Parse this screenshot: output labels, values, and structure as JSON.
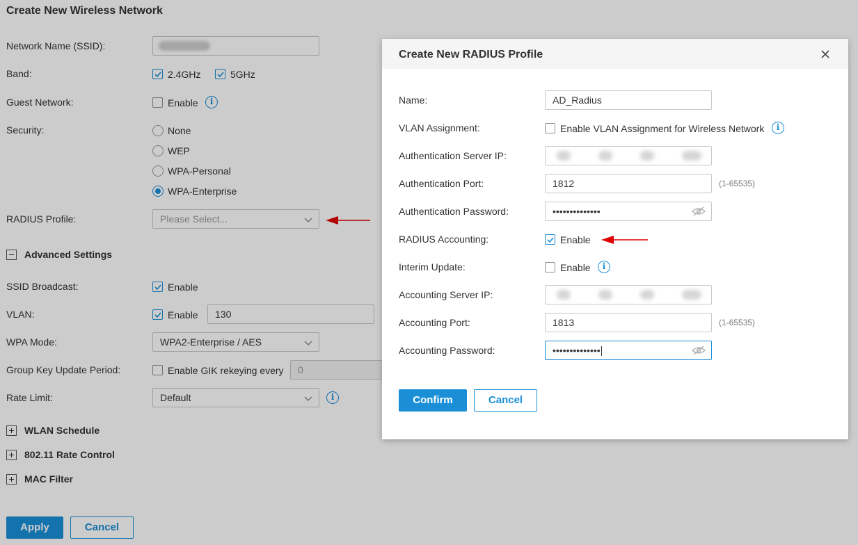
{
  "page": {
    "title": "Create New Wireless Network",
    "ssid_label": "Network Name (SSID):",
    "band_label": "Band:",
    "band_24": "2.4GHz",
    "band_5": "5GHz",
    "guest_label": "Guest Network:",
    "guest_enable": "Enable",
    "security_label": "Security:",
    "security_options": [
      "None",
      "WEP",
      "WPA-Personal",
      "WPA-Enterprise"
    ],
    "security_selected": "WPA-Enterprise",
    "radius_label": "RADIUS Profile:",
    "radius_placeholder": "Please Select...",
    "advanced_title": "Advanced Settings",
    "ssid_broadcast_label": "SSID Broadcast:",
    "ssid_broadcast_enable": "Enable",
    "vlan_label": "VLAN:",
    "vlan_enable": "Enable",
    "vlan_value": "130",
    "wpa_mode_label": "WPA Mode:",
    "wpa_mode_value": "WPA2-Enterprise / AES",
    "gik_label": "Group Key Update Period:",
    "gik_enable": "Enable GIK rekeying every",
    "gik_value": "0",
    "rate_limit_label": "Rate Limit:",
    "rate_limit_value": "Default",
    "wlan_schedule": "WLAN Schedule",
    "rate_control": "802.11 Rate Control",
    "mac_filter": "MAC Filter",
    "apply": "Apply",
    "cancel": "Cancel"
  },
  "modal": {
    "title": "Create New RADIUS Profile",
    "name_label": "Name:",
    "name_value": "AD_Radius",
    "vlan_assign_label": "VLAN Assignment:",
    "vlan_assign_text": "Enable VLAN Assignment for Wireless Network",
    "auth_ip_label": "Authentication Server IP:",
    "auth_port_label": "Authentication Port:",
    "auth_port_value": "1812",
    "auth_port_range": "(1-65535)",
    "auth_pw_label": "Authentication Password:",
    "auth_pw_value": "••••••••••••••",
    "acct_label": "RADIUS Accounting:",
    "acct_enable": "Enable",
    "interim_label": "Interim Update:",
    "interim_enable": "Enable",
    "acct_ip_label": "Accounting Server IP:",
    "acct_port_label": "Accounting Port:",
    "acct_port_value": "1813",
    "acct_port_range": "(1-65535)",
    "acct_pw_label": "Accounting Password:",
    "acct_pw_value": "••••••••••••••",
    "confirm": "Confirm",
    "cancel": "Cancel"
  },
  "colors": {
    "accent": "#1a8fd8",
    "arrow": "#e00000"
  }
}
